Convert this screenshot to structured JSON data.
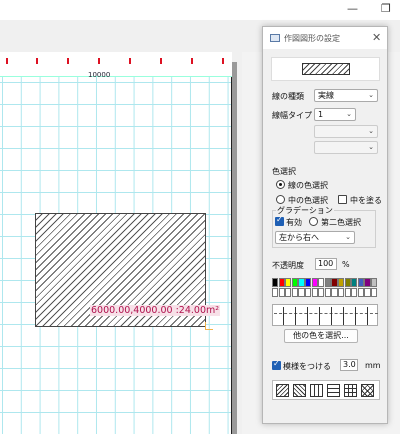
{
  "window": {
    "minimize_glyph": "—",
    "restore_glyph": "❐"
  },
  "canvas": {
    "ruler_label": "10000",
    "dimension_text": "6000.00,4000.00   :24.00m²",
    "grid_color": "#aee7ee",
    "ruler_tick_color": "#dd1122"
  },
  "dialog": {
    "title": "作図図形の設定",
    "close_glyph": "✕",
    "line_type_label": "線の種類",
    "line_type_value": "実線",
    "line_width_label": "線幅タイプ",
    "line_width_value": "1",
    "color_section_label": "色選択",
    "radio_line_color": "線の色選択",
    "radio_inner_color": "中の色選択",
    "fill_inside_label": "中を塗る",
    "gradation_label": "グラデーション",
    "gradation_enabled_label": "有効",
    "second_color_label": "第二色選択",
    "gradation_direction": "左から右へ",
    "opacity_label": "不透明度",
    "opacity_value": "100",
    "opacity_unit": "%",
    "other_colors_button": "他の色を選択...",
    "hatch_label": "模様をつける",
    "hatch_value": "3.0",
    "hatch_unit": "mm",
    "palette_colors": [
      "#000000",
      "#ff0000",
      "#ffff00",
      "#00ff00",
      "#00ffff",
      "#0000ff",
      "#ff00ff",
      "#ffffff",
      "#808080",
      "#800000",
      "#c0a000",
      "#808000",
      "#008080",
      "#4060c0",
      "#800080",
      "#c0c0c0"
    ],
    "palette_row2": [
      "#ffffff",
      "#ffffff",
      "#ffffff",
      "#ffffff",
      "#ffffff",
      "#ffffff",
      "#ffffff",
      "#ffffff",
      "#ffffff",
      "#ffffff",
      "#ffffff",
      "#ffffff",
      "#ffffff",
      "#ffffff",
      "#ffffff",
      "#ffffff"
    ],
    "accent_color": "#1e5fb4"
  }
}
